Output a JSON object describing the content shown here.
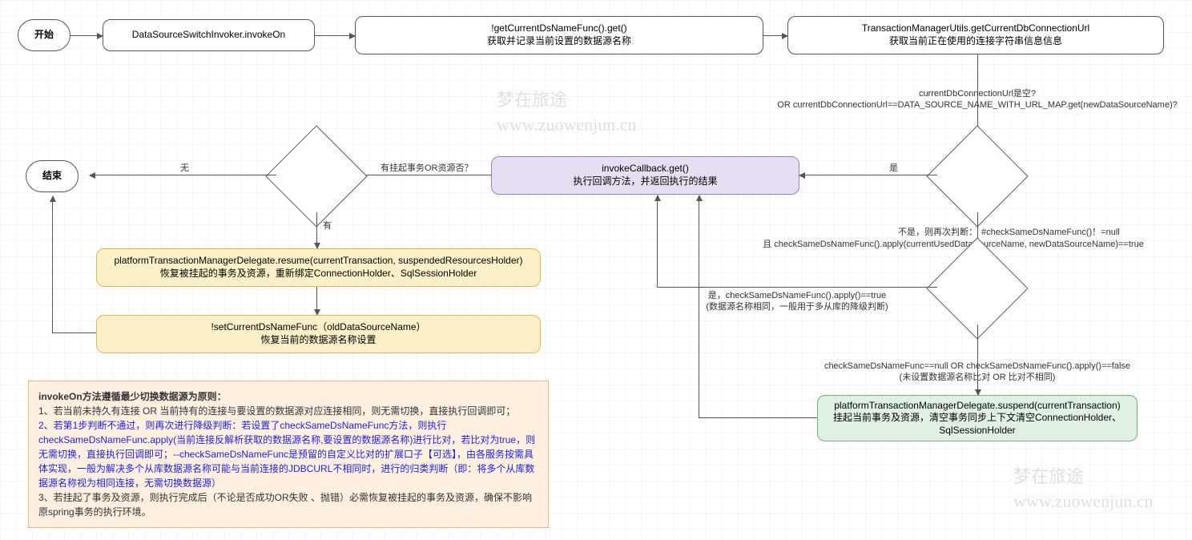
{
  "nodes": {
    "start": "开始",
    "invokeOn": "DataSourceSwitchInvoker.invokeOn",
    "getCurrent_title": "!getCurrentDsNameFunc().get()",
    "getCurrent_sub": "获取并记录当前设置的数据源名称",
    "txUtil_title": "TransactionManagerUtils.getCurrentDbConnectionUrl",
    "txUtil_sub": "获取当前正在使用的连接字符串信息信息",
    "cond1_line1": "currentDbConnectionUrl是空?",
    "cond1_line2": "OR currentDbConnectionUrl==DATA_SOURCE_NAME_WITH_URL_MAP.get(newDataSourceName)?",
    "cond1_yes": "是",
    "cond2_label_a": "不是，则再次判断：",
    "cond2_label_b": "#checkSameDsNameFunc()！=null",
    "cond2_label_c": "且 checkSameDsNameFunc().apply(currentUsedDataSourceName, newDataSourceName)==true",
    "cond2_yes_a": "是，checkSameDsNameFunc().apply()==true",
    "cond2_yes_b": "(数据源名称相同，一般用于多从库的降级判断)",
    "cond2_no_a": "checkSameDsNameFunc==null  OR  checkSameDsNameFunc().apply()==false",
    "cond2_no_b": "(未设置数据源名称比对 OR 比对不相同)",
    "suspend_title": "platformTransactionManagerDelegate.suspend(currentTransaction)",
    "suspend_sub": "挂起当前事务及资源，清空事务同步上下文清空ConnectionHolder、SqlSessionHolder",
    "callback_title": "invokeCallback.get()",
    "callback_sub": "执行回调方法，并返回执行的结果",
    "cond3_label": "有挂起事务OR资源否？",
    "cond3_no": "无",
    "cond3_yes": "有",
    "resume_title": "platformTransactionManagerDelegate.resume(currentTransaction, suspendedResourcesHolder)",
    "resume_sub": "恢复被挂起的事务及资源，重新绑定ConnectionHolder、SqlSessionHolder",
    "setCurrent_title": "!setCurrentDsNameFunc（oldDataSourceName）",
    "setCurrent_sub": "恢复当前的数据源名称设置",
    "end": "结束"
  },
  "note": {
    "title": "invokeOn方法遵循最少切换数据源为原则：",
    "p1": "1、若当前未持久有连接 OR 当前持有的连接与要设置的数据源对应连接相同，则无需切换，直接执行回调即可；",
    "p2a": "2、若第1步判断不通过，则再次进行降级判断：若设置了checkSameDsNameFunc方法，则执行checkSameDsNameFunc.apply(当前连接反解析获取的数据源名称,要设置的数据源名称)进行比对，若比对为true，则无需切换，直接执行回调即可；",
    "p2b": "--checkSameDsNameFunc是预留的自定义比对的扩展口子【可选】，由各服务按需具体实现，一般为解决多个从库数据源名称可能与当前连接的JDBCURL不相同时，进行的归类判断（即：将多个从库数据源名称视为相同连接，无需切换数据源）",
    "p3": "3、若挂起了事务及资源，则执行完成后（不论是否成功OR失败 、抛错）必需恢复被挂起的事务及资源，确保不影响原spring事务的执行环境。"
  },
  "watermark": {
    "line1": "梦在旅途",
    "line2": "www.zuowenjun.cn"
  }
}
